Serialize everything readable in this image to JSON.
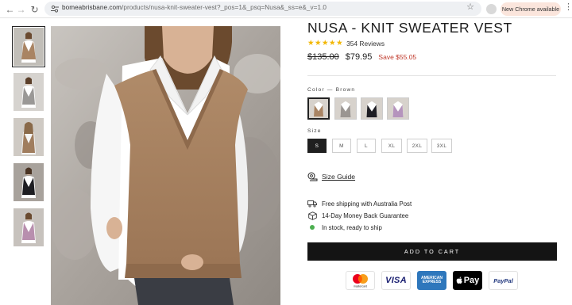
{
  "browser": {
    "url_host": "bomeabrisbane.com",
    "url_path": "/products/nusa-knit-sweater-vest?_pos=1&_psq=Nusa&_ss=e&_v=1.0",
    "update_label": "New Chrome available"
  },
  "gallery": {
    "thumbnails": [
      {
        "name": "brown",
        "selected": true
      },
      {
        "name": "grey"
      },
      {
        "name": "brown-long"
      },
      {
        "name": "black"
      },
      {
        "name": "pink"
      }
    ]
  },
  "product": {
    "title": "NUSA - KNIT SWEATER VEST",
    "stars": "★★★★★",
    "reviews": "354 Reviews",
    "old_price": "$135.00",
    "price": "$79.95",
    "save": "Save $55.05",
    "color_label": "Color — Brown",
    "colors": [
      "Brown",
      "Grey",
      "Black",
      "Lilac"
    ],
    "size_label": "Size",
    "sizes": [
      "S",
      "M",
      "L",
      "XL",
      "2XL",
      "3XL"
    ],
    "selected_size": "S",
    "size_guide": "Size Guide",
    "perks": {
      "shipping": "Free shipping with Australia Post",
      "guarantee": "14-Day Money Back Guarantee",
      "stock": "In stock, ready to ship"
    },
    "add_to_cart": "ADD TO CART"
  },
  "payments": {
    "mastercard": "mastercard",
    "visa": "VISA",
    "amex_top": "AMERICAN",
    "amex_bottom": "EXPRESS",
    "applepay": "Pay",
    "paypal": "PayPal"
  },
  "colors": {
    "accent_dark": "#141414",
    "sale_red": "#c0392b",
    "star_gold": "#f2b705",
    "vest_brown": "#a98463",
    "stock_green": "#4caf50"
  }
}
